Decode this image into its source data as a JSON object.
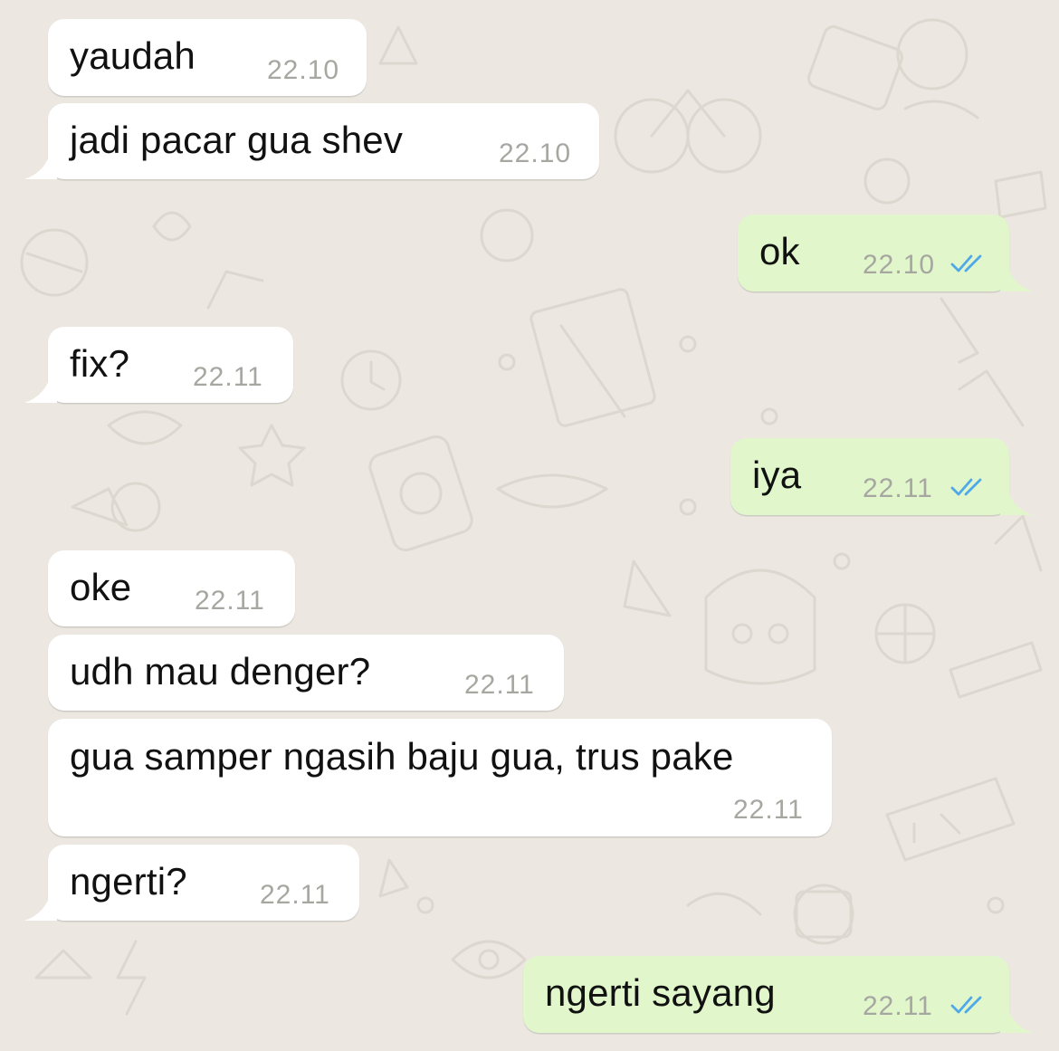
{
  "messages": [
    {
      "text": "yaudah",
      "time": "22.10"
    },
    {
      "text": "jadi pacar gua shev",
      "time": "22.10"
    },
    {
      "text": "ok",
      "time": "22.10",
      "status": "read"
    },
    {
      "text": "fix?",
      "time": "22.11"
    },
    {
      "text": "iya",
      "time": "22.11",
      "status": "read"
    },
    {
      "text": "oke",
      "time": "22.11"
    },
    {
      "text": "udh mau denger?",
      "time": "22.11"
    },
    {
      "text": "gua samper ngasih baju gua, trus pake",
      "time": "22.11"
    },
    {
      "text": "ngerti?",
      "time": "22.11"
    },
    {
      "text": "ngerti sayang",
      "time": "22.11",
      "status": "read"
    }
  ],
  "colors": {
    "background": "#ece8e1",
    "incoming_bubble": "#ffffff",
    "outgoing_bubble": "#e1f7cb",
    "read_ticks": "#4fa8e8",
    "timestamp": "#a7a7a2"
  },
  "icons": {
    "read_receipt": "double-check-icon"
  }
}
